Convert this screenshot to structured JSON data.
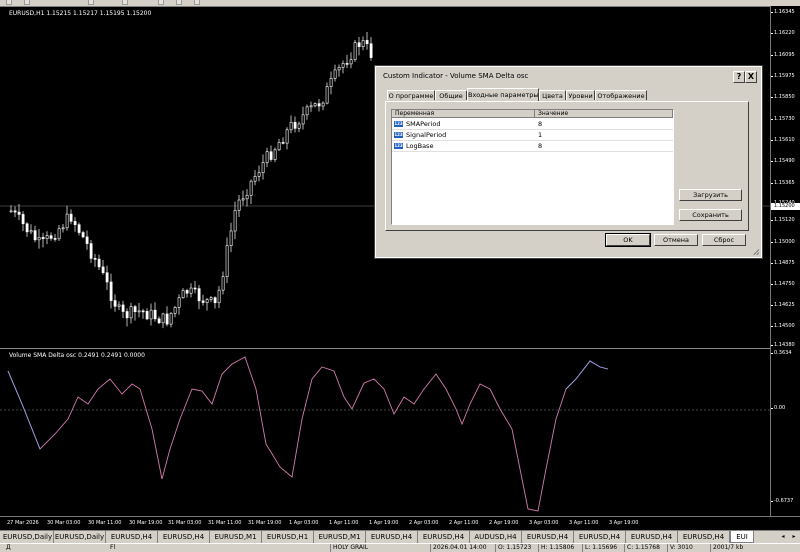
{
  "main_chart": {
    "label": "EURUSD,H1  1.15215 1.15217 1.15195 1.15200",
    "current_price": "1.15200",
    "price_ticks": [
      "1.16345",
      "1.16220",
      "1.16095",
      "1.15975",
      "1.15850",
      "1.15730",
      "1.15610",
      "1.15490",
      "1.15365",
      "1.15240",
      "1.15120",
      "1.15000",
      "1.14875",
      "1.14750",
      "1.14625",
      "1.14500",
      "1.14380"
    ],
    "candle_color": "#ffffff"
  },
  "indicator": {
    "label": "Volume SMA Delta osc 0.2491 0.2491 0.0000",
    "axis_top": "0.3634",
    "axis_zero": "0.00",
    "axis_bottom": "-0.6737",
    "line_color": "#d47ab0",
    "line_color_2": "#8aa0e6",
    "zero_line_color": "#888888"
  },
  "time_axis": [
    "27 Mar 2026",
    "30 Mar 03:00",
    "30 Mar 11:00",
    "30 Mar 19:00",
    "31 Mar 03:00",
    "31 Mar 11:00",
    "31 Mar 19:00",
    "1 Apr 03:00",
    "1 Apr 11:00",
    "1 Apr 19:00",
    "2 Apr 03:00",
    "2 Apr 11:00",
    "2 Apr 19:00",
    "3 Apr 03:00",
    "3 Apr 11:00",
    "3 Apr 19:00"
  ],
  "dialog": {
    "title": "Custom Indicator - Volume SMA Delta osc",
    "help_button": "?",
    "close_button": "X",
    "tabs": [
      "О программе",
      "Общие",
      "Входные параметры",
      "Цвета",
      "Уровни",
      "Отображение"
    ],
    "active_tab": 2,
    "columns": [
      "Переменная",
      "Значение"
    ],
    "params": [
      {
        "icon": "123",
        "name": "SMAPeriod",
        "value": "8"
      },
      {
        "icon": "123",
        "name": "SignalPeriod",
        "value": "1"
      },
      {
        "icon": "123",
        "name": "LogBase",
        "value": "8"
      }
    ],
    "load_button": "Загрузить",
    "save_button": "Сохранить",
    "ok_button": "OK",
    "cancel_button": "Отмена",
    "reset_button": "Сброс"
  },
  "chart_tabs": [
    "EURUSD,Daily",
    "EURUSD,Daily",
    "EURUSD,H4",
    "EURUSD,H4",
    "EURUSD,M1",
    "EURUSD,H1",
    "EURUSD,M1",
    "EURUSD,H4",
    "EURUSD,H4",
    "AUDUSD,H4",
    "EURUSD,H4",
    "EURUSD,H4",
    "EURUSD,H4",
    "EURUSD,H4",
    "EUI"
  ],
  "active_chart_tab": 14,
  "status_bar": [
    "Д",
    "Fl",
    "HOLY GRAIL",
    "2026.04.01 14:00",
    "O: 1.15723",
    "H: 1.15806",
    "L: 1.15696",
    "C: 1.15768",
    "V: 3010",
    "2001/7 kb"
  ]
}
